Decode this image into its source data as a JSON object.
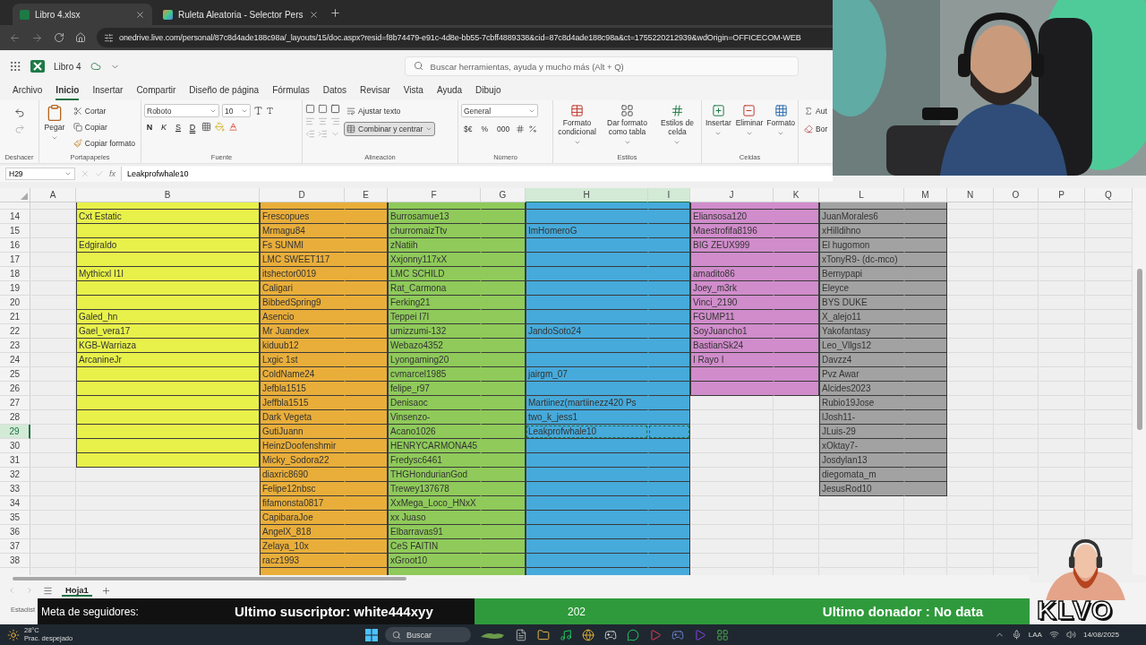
{
  "browser": {
    "tabs": [
      {
        "title": "Libro 4.xlsx",
        "selected": true
      },
      {
        "title": "Ruleta Aleatoria - Selector Pers",
        "selected": false
      }
    ],
    "url": "onedrive.live.com/personal/87c8d4ade188c98a/_layouts/15/doc.aspx?resid=f8b74479-e91c-4d8e-bb55-7cbff4889338&cid=87c8d4ade188c98a&ct=1755220212939&wdOrigin=OFFICECOM-WEB"
  },
  "app": {
    "file_name": "Libro 4",
    "search": {
      "placeholder": "Buscar herramientas, ayuda y mucho más (Alt + Q)"
    }
  },
  "menu": [
    {
      "label": "Archivo",
      "selected": false
    },
    {
      "label": "Inicio",
      "selected": true
    },
    {
      "label": "Insertar",
      "selected": false
    },
    {
      "label": "Compartir",
      "selected": false
    },
    {
      "label": "Diseño de página",
      "selected": false
    },
    {
      "label": "Fórmulas",
      "selected": false
    },
    {
      "label": "Datos",
      "selected": false
    },
    {
      "label": "Revisar",
      "selected": false
    },
    {
      "label": "Vista",
      "selected": false
    },
    {
      "label": "Ayuda",
      "selected": false
    },
    {
      "label": "Dibujo",
      "selected": false
    }
  ],
  "ribbon": {
    "undo": {
      "label": "Deshacer"
    },
    "clipboard": {
      "label": "Portapapeles",
      "paste": "Pegar",
      "items": [
        "Cortar",
        "Copiar",
        "Copiar formato"
      ]
    },
    "font": {
      "label": "Fuente",
      "font_name": "Roboto",
      "font_size": "10",
      "styles": [
        "N",
        "K",
        "S",
        "D"
      ]
    },
    "alignment": {
      "label": "Alineación",
      "wrap": "Ajustar texto",
      "merge": {
        "label": "Combinar y centrar",
        "on": true
      }
    },
    "number": {
      "label": "Número",
      "format": "General",
      "buttons": [
        "$€",
        "%",
        "000"
      ]
    },
    "styles": {
      "label": "Estilos",
      "items": [
        "Formato condicional",
        "Dar formato como tabla",
        "Estilos de celda"
      ]
    },
    "cells": {
      "label": "Celdas",
      "items": [
        "Insertar",
        "Eliminar",
        "Formato"
      ]
    },
    "editing": {
      "items": [
        "Aut",
        "Bor"
      ]
    }
  },
  "formula_bar": {
    "name_box": "H29",
    "fx": "fx",
    "value": "Leakprofwhale10"
  },
  "grid": {
    "columns": [
      {
        "label": "A",
        "selected": false
      },
      {
        "label": "B",
        "selected": false
      },
      {
        "label": "D",
        "selected": false
      },
      {
        "label": "E",
        "selected": false
      },
      {
        "label": "F",
        "selected": false
      },
      {
        "label": "G",
        "selected": false
      },
      {
        "label": "H",
        "selected": true
      },
      {
        "label": "I",
        "selected": true
      },
      {
        "label": "J",
        "selected": false
      },
      {
        "label": "K",
        "selected": false
      },
      {
        "label": "L",
        "selected": false
      },
      {
        "label": "M",
        "selected": false
      },
      {
        "label": "N",
        "selected": false
      },
      {
        "label": "O",
        "selected": false
      },
      {
        "label": "P",
        "selected": false
      },
      {
        "label": "Q",
        "selected": false
      }
    ],
    "bands": [
      {
        "color": "#e8f14a"
      },
      {
        "color": "#e9ae3a"
      },
      {
        "color": "#8fca5a"
      },
      {
        "color": "#46aadb"
      },
      {
        "color": "#d08ccb"
      },
      {
        "color": "#a2a2a2"
      }
    ],
    "rows": [
      {
        "selected": false,
        "cells": [
          {
            "filled": false
          },
          {
            "filled": true
          },
          {
            "filled": true
          },
          {
            "filled": true
          },
          {
            "filled": true
          },
          {
            "filled": true
          },
          {
            "filled": true
          },
          {
            "filled": true
          },
          {
            "filled": true
          },
          {
            "filled": true
          },
          {
            "filled": true
          },
          {
            "filled": true
          }
        ]
      },
      {
        "number": "14",
        "selected": false,
        "cells": [
          {
            "filled": false
          },
          {
            "filled": true,
            "text": "Cxt Estatic"
          },
          {
            "filled": true,
            "text": "Frescopues"
          },
          {
            "filled": true
          },
          {
            "filled": true,
            "text": "Burrosamue13"
          },
          {
            "filled": true
          },
          {
            "filled": true
          },
          {
            "filled": true
          },
          {
            "filled": true,
            "text": "Eliansosa120"
          },
          {
            "filled": true
          },
          {
            "filled": true,
            "text": "JuanMorales6"
          },
          {
            "filled": true
          }
        ]
      },
      {
        "number": "15",
        "selected": false,
        "cells": [
          {
            "filled": false
          },
          {
            "filled": true
          },
          {
            "filled": true,
            "text": "Mrmagu84"
          },
          {
            "filled": true
          },
          {
            "filled": true,
            "text": "churromaizTtv"
          },
          {
            "filled": true
          },
          {
            "filled": true,
            "text": "ImHomeroG"
          },
          {
            "filled": true
          },
          {
            "filled": true,
            "text": "Maestrofifa8196"
          },
          {
            "filled": true
          },
          {
            "filled": true,
            "text": "xHilldihno"
          },
          {
            "filled": true
          }
        ]
      },
      {
        "number": "16",
        "selected": false,
        "cells": [
          {
            "filled": false
          },
          {
            "filled": true,
            "text": "Edgiraldo"
          },
          {
            "filled": true,
            "text": "Fs SUNMI"
          },
          {
            "filled": true
          },
          {
            "filled": true,
            "text": "zNatiih"
          },
          {
            "filled": true
          },
          {
            "filled": true
          },
          {
            "filled": true
          },
          {
            "filled": true,
            "text": "BIG ZEUX999"
          },
          {
            "filled": true
          },
          {
            "filled": true,
            "text": "El hugomon"
          },
          {
            "filled": true
          }
        ]
      },
      {
        "number": "17",
        "selected": false,
        "cells": [
          {
            "filled": false
          },
          {
            "filled": true
          },
          {
            "filled": true,
            "text": "LMC SWEET117"
          },
          {
            "filled": true
          },
          {
            "filled": true,
            "text": "Xxjonny117xX"
          },
          {
            "filled": true
          },
          {
            "filled": true
          },
          {
            "filled": true
          },
          {
            "filled": true
          },
          {
            "filled": true
          },
          {
            "filled": true,
            "text": "xTonyR9- (dc-mco)"
          },
          {
            "filled": true
          }
        ]
      },
      {
        "number": "18",
        "selected": false,
        "cells": [
          {
            "filled": false
          },
          {
            "filled": true,
            "text": "Mythicxl I1I"
          },
          {
            "filled": true,
            "text": "itshector0019"
          },
          {
            "filled": true
          },
          {
            "filled": true,
            "text": "LMC SCHILD"
          },
          {
            "filled": true
          },
          {
            "filled": true
          },
          {
            "filled": true
          },
          {
            "filled": true,
            "text": "amadito86"
          },
          {
            "filled": true
          },
          {
            "filled": true,
            "text": "Bernypapi"
          },
          {
            "filled": true
          }
        ]
      },
      {
        "number": "19",
        "selected": false,
        "cells": [
          {
            "filled": false
          },
          {
            "filled": true
          },
          {
            "filled": true,
            "text": "Caligari"
          },
          {
            "filled": true
          },
          {
            "filled": true,
            "text": "Rat_Carmona"
          },
          {
            "filled": true
          },
          {
            "filled": true
          },
          {
            "filled": true
          },
          {
            "filled": true,
            "text": "Joey_m3rk"
          },
          {
            "filled": true
          },
          {
            "filled": true,
            "text": "Eleyce"
          },
          {
            "filled": true
          }
        ]
      },
      {
        "number": "20",
        "selected": false,
        "cells": [
          {
            "filled": false
          },
          {
            "filled": true
          },
          {
            "filled": true,
            "text": "BibbedSpring9"
          },
          {
            "filled": true
          },
          {
            "filled": true,
            "text": "Ferking21"
          },
          {
            "filled": true
          },
          {
            "filled": true
          },
          {
            "filled": true
          },
          {
            "filled": true,
            "text": "Vinci_2190"
          },
          {
            "filled": true
          },
          {
            "filled": true,
            "text": "BYS DUKE"
          },
          {
            "filled": true
          }
        ]
      },
      {
        "number": "21",
        "selected": false,
        "cells": [
          {
            "filled": false
          },
          {
            "filled": true,
            "text": "Galed_hn"
          },
          {
            "filled": true,
            "text": "Asencio"
          },
          {
            "filled": true
          },
          {
            "filled": true,
            "text": "Teppei I7I"
          },
          {
            "filled": true
          },
          {
            "filled": true
          },
          {
            "filled": true
          },
          {
            "filled": true,
            "text": "FGUMP11"
          },
          {
            "filled": true
          },
          {
            "filled": true,
            "text": "X_alejo11"
          },
          {
            "filled": true
          }
        ]
      },
      {
        "number": "22",
        "selected": false,
        "cells": [
          {
            "filled": false
          },
          {
            "filled": true,
            "text": "Gael_vera17"
          },
          {
            "filled": true,
            "text": "Mr Juandex"
          },
          {
            "filled": true
          },
          {
            "filled": true,
            "text": "umizzumi-132"
          },
          {
            "filled": true
          },
          {
            "filled": true,
            "text": "JandoSoto24"
          },
          {
            "filled": true
          },
          {
            "filled": true,
            "text": "SoyJuancho1"
          },
          {
            "filled": true
          },
          {
            "filled": true,
            "text": "Yakofantasy"
          },
          {
            "filled": true
          }
        ]
      },
      {
        "number": "23",
        "selected": false,
        "cells": [
          {
            "filled": false
          },
          {
            "filled": true,
            "text": "KGB-Warriaza"
          },
          {
            "filled": true,
            "text": "kiduub12"
          },
          {
            "filled": true
          },
          {
            "filled": true,
            "text": "Webazo4352"
          },
          {
            "filled": true
          },
          {
            "filled": true
          },
          {
            "filled": true
          },
          {
            "filled": true,
            "text": "BastianSk24"
          },
          {
            "filled": true
          },
          {
            "filled": true,
            "text": "Leo_Vllgs12"
          },
          {
            "filled": true
          }
        ]
      },
      {
        "number": "24",
        "selected": false,
        "cells": [
          {
            "filled": false
          },
          {
            "filled": true,
            "text": "ArcanineJr"
          },
          {
            "filled": true,
            "text": "Lxgic 1st"
          },
          {
            "filled": true
          },
          {
            "filled": true,
            "text": "Lyongaming20"
          },
          {
            "filled": true
          },
          {
            "filled": true
          },
          {
            "filled": true
          },
          {
            "filled": true,
            "text": "I Rayo I"
          },
          {
            "filled": true
          },
          {
            "filled": true,
            "text": "Davzz4"
          },
          {
            "filled": true
          }
        ]
      },
      {
        "number": "25",
        "selected": false,
        "cells": [
          {
            "filled": false
          },
          {
            "filled": true
          },
          {
            "filled": true,
            "text": "ColdName24"
          },
          {
            "filled": true
          },
          {
            "filled": true,
            "text": "cvmarcel1985"
          },
          {
            "filled": true
          },
          {
            "filled": true,
            "text": "jairgm_07"
          },
          {
            "filled": true
          },
          {
            "filled": true
          },
          {
            "filled": true
          },
          {
            "filled": true,
            "text": "Pvz Awar"
          },
          {
            "filled": true
          }
        ]
      },
      {
        "number": "26",
        "selected": false,
        "cells": [
          {
            "filled": false
          },
          {
            "filled": true
          },
          {
            "filled": true,
            "text": "Jefbla1515"
          },
          {
            "filled": true
          },
          {
            "filled": true,
            "text": "felipe_r97"
          },
          {
            "filled": true
          },
          {
            "filled": true
          },
          {
            "filled": true
          },
          {
            "filled": true
          },
          {
            "filled": true
          },
          {
            "filled": true,
            "text": "Alcides2023"
          },
          {
            "filled": true
          }
        ]
      },
      {
        "number": "27",
        "selected": false,
        "cells": [
          {
            "filled": false
          },
          {
            "filled": true
          },
          {
            "filled": true,
            "text": "Jeffbla1515"
          },
          {
            "filled": true
          },
          {
            "filled": true,
            "text": "Denisaoc"
          },
          {
            "filled": true
          },
          {
            "filled": true,
            "text": "Martiinez(martiinezz420 Ps"
          },
          {
            "filled": true
          },
          {
            "filled": false
          },
          {
            "filled": false
          },
          {
            "filled": true,
            "text": "Rubio19Jose"
          },
          {
            "filled": true
          }
        ]
      },
      {
        "number": "28",
        "selected": false,
        "cells": [
          {
            "filled": false
          },
          {
            "filled": true
          },
          {
            "filled": true,
            "text": "Dark Vegeta"
          },
          {
            "filled": true
          },
          {
            "filled": true,
            "text": "Vinsenzo-"
          },
          {
            "filled": true
          },
          {
            "filled": true,
            "text": "two_k_jess1"
          },
          {
            "filled": true
          },
          {
            "filled": false
          },
          {
            "filled": false
          },
          {
            "filled": true,
            "text": "lJosh11-"
          },
          {
            "filled": true
          }
        ]
      },
      {
        "number": "29",
        "selected": true,
        "cells": [
          {
            "filled": false
          },
          {
            "filled": true
          },
          {
            "filled": true,
            "text": "GutiJuann"
          },
          {
            "filled": true
          },
          {
            "filled": true,
            "text": "Acano1026"
          },
          {
            "filled": true
          },
          {
            "filled": true,
            "text": "Leakprofwhale10"
          },
          {
            "filled": true
          },
          {
            "filled": false
          },
          {
            "filled": false
          },
          {
            "filled": true,
            "text": "JLuis-29"
          },
          {
            "filled": true
          }
        ]
      },
      {
        "number": "30",
        "selected": false,
        "cells": [
          {
            "filled": false
          },
          {
            "filled": true
          },
          {
            "filled": true,
            "text": "HeinzDoofenshmir"
          },
          {
            "filled": true
          },
          {
            "filled": true,
            "text": "HENRYCARMONA45"
          },
          {
            "filled": true
          },
          {
            "filled": true
          },
          {
            "filled": true
          },
          {
            "filled": false
          },
          {
            "filled": false
          },
          {
            "filled": true,
            "text": "xOktay7-"
          },
          {
            "filled": true
          }
        ]
      },
      {
        "number": "31",
        "selected": false,
        "cells": [
          {
            "filled": false
          },
          {
            "filled": true
          },
          {
            "filled": true,
            "text": "Micky_Sodora22"
          },
          {
            "filled": true
          },
          {
            "filled": true,
            "text": "Fredysc6461"
          },
          {
            "filled": true
          },
          {
            "filled": true
          },
          {
            "filled": true
          },
          {
            "filled": false
          },
          {
            "filled": false
          },
          {
            "filled": true,
            "text": "Josdylan13"
          },
          {
            "filled": true
          }
        ]
      },
      {
        "number": "32",
        "selected": false,
        "cells": [
          {
            "filled": false
          },
          {
            "filled": false
          },
          {
            "filled": true,
            "text": "diaxric8690"
          },
          {
            "filled": true
          },
          {
            "filled": true,
            "text": "THGHondurianGod"
          },
          {
            "filled": true
          },
          {
            "filled": true
          },
          {
            "filled": true
          },
          {
            "filled": false
          },
          {
            "filled": false
          },
          {
            "filled": true,
            "text": "diegomata_m"
          },
          {
            "filled": true
          }
        ]
      },
      {
        "number": "33",
        "selected": false,
        "cells": [
          {
            "filled": false
          },
          {
            "filled": false
          },
          {
            "filled": true,
            "text": "Felipe12nbsc"
          },
          {
            "filled": true
          },
          {
            "filled": true,
            "text": "Trewey137678"
          },
          {
            "filled": true
          },
          {
            "filled": true
          },
          {
            "filled": true
          },
          {
            "filled": false
          },
          {
            "filled": false
          },
          {
            "filled": true,
            "text": "JesusRod10"
          },
          {
            "filled": true
          }
        ]
      },
      {
        "number": "34",
        "selected": false,
        "cells": [
          {
            "filled": false
          },
          {
            "filled": false
          },
          {
            "filled": true,
            "text": "fifamonsta0817"
          },
          {
            "filled": true
          },
          {
            "filled": true,
            "text": "XxMega_Loco_HNxX"
          },
          {
            "filled": true
          },
          {
            "filled": true
          },
          {
            "filled": true
          },
          {
            "filled": false
          },
          {
            "filled": false
          },
          {
            "filled": false
          },
          {
            "filled": false
          }
        ]
      },
      {
        "number": "35",
        "selected": false,
        "cells": [
          {
            "filled": false
          },
          {
            "filled": false
          },
          {
            "filled": true,
            "text": "CapibaraJoe"
          },
          {
            "filled": true
          },
          {
            "filled": true,
            "text": "xx Juaso"
          },
          {
            "filled": true
          },
          {
            "filled": true
          },
          {
            "filled": true
          },
          {
            "filled": false
          },
          {
            "filled": false
          },
          {
            "filled": false
          },
          {
            "filled": false
          }
        ]
      },
      {
        "number": "36",
        "selected": false,
        "cells": [
          {
            "filled": false
          },
          {
            "filled": false
          },
          {
            "filled": true,
            "text": "AngelX_818"
          },
          {
            "filled": true
          },
          {
            "filled": true,
            "text": "Elbarravas91"
          },
          {
            "filled": true
          },
          {
            "filled": true
          },
          {
            "filled": true
          },
          {
            "filled": false
          },
          {
            "filled": false
          },
          {
            "filled": false
          },
          {
            "filled": false
          }
        ]
      },
      {
        "number": "37",
        "selected": false,
        "cells": [
          {
            "filled": false
          },
          {
            "filled": false
          },
          {
            "filled": true,
            "text": "Zelaya_10x"
          },
          {
            "filled": true
          },
          {
            "filled": true,
            "text": "CeS FAITIN"
          },
          {
            "filled": true
          },
          {
            "filled": true
          },
          {
            "filled": true
          },
          {
            "filled": false
          },
          {
            "filled": false
          },
          {
            "filled": false
          },
          {
            "filled": false
          }
        ]
      },
      {
        "number": "38",
        "selected": false,
        "cells": [
          {
            "filled": false
          },
          {
            "filled": false
          },
          {
            "filled": true,
            "text": "racz1993"
          },
          {
            "filled": true
          },
          {
            "filled": true,
            "text": "xGroot10"
          },
          {
            "filled": true
          },
          {
            "filled": true
          },
          {
            "filled": true
          },
          {
            "filled": false
          },
          {
            "filled": false
          },
          {
            "filled": false
          },
          {
            "filled": false
          }
        ]
      },
      {
        "selected": false,
        "cells": [
          {
            "filled": false
          },
          {
            "filled": false
          },
          {
            "filled": true
          },
          {
            "filled": true
          },
          {
            "filled": true
          },
          {
            "filled": true
          },
          {
            "filled": true
          },
          {
            "filled": true
          },
          {
            "filled": false
          },
          {
            "filled": false
          },
          {
            "filled": false
          },
          {
            "filled": false
          }
        ]
      }
    ]
  },
  "sheet_tabs": [
    {
      "label": "Hoja1",
      "selected": true
    }
  ],
  "status_bar": {
    "text": "Estadíst"
  },
  "stream_overlay": {
    "follower_goal": "Meta de seguidores:",
    "subscriber": "Ultimo suscriptor: white444xyy",
    "count": "202",
    "donor": "Ultimo donador : No data",
    "logo": "KLVO"
  },
  "taskbar": {
    "weather": {
      "temp": "28°C",
      "condition": "Prac. despejado"
    },
    "search": "Buscar",
    "language": "LAA",
    "date": "14/08/2025"
  }
}
